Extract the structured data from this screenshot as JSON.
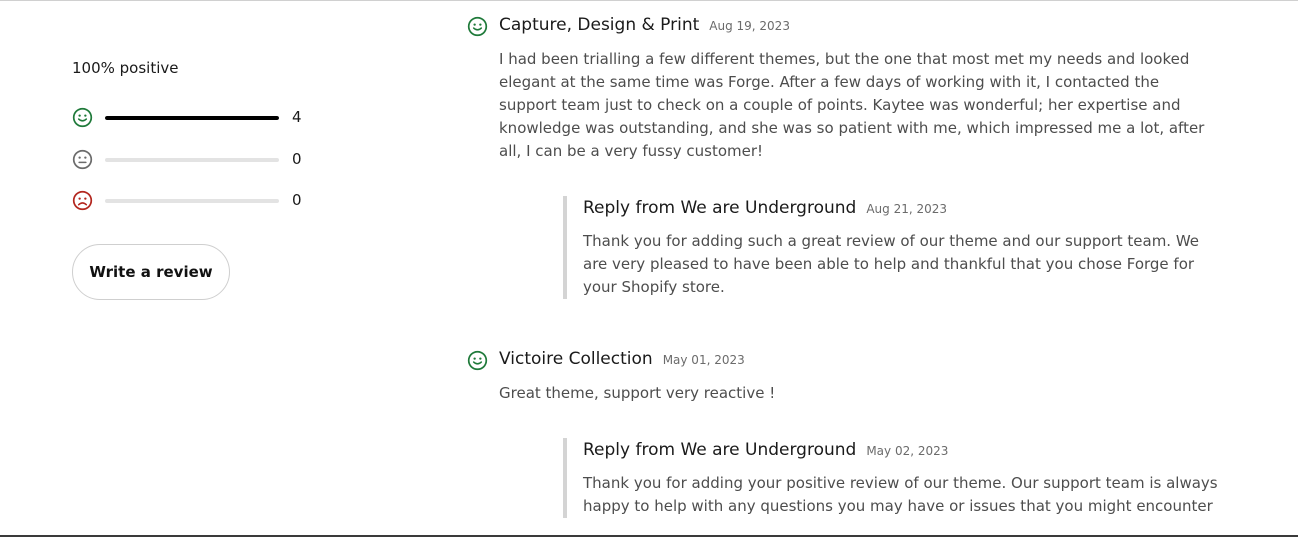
{
  "summary": {
    "title": "100% positive",
    "ratings": [
      {
        "kind": "positive",
        "icon": "smile-icon",
        "count": "4",
        "fraction": 1.0,
        "color": "#1f7a3a"
      },
      {
        "kind": "neutral",
        "icon": "neutral-face-icon",
        "count": "0",
        "fraction": 0,
        "color": "#6b6b6b"
      },
      {
        "kind": "negative",
        "icon": "frown-icon",
        "count": "0",
        "fraction": 0,
        "color": "#b3261e"
      }
    ],
    "write_review_label": "Write a review"
  },
  "reviews": [
    {
      "reviewer": "Capture, Design & Print",
      "date": "Aug 19, 2023",
      "sentiment": "positive",
      "body": "I had been trialling a few different themes, but the one that most met my needs and looked elegant at the same time was Forge. After a few days of working with it, I contacted the support team just to check on a couple of points. Kaytee was wonderful; her expertise and knowledge was outstanding, and she was so patient with me, which impressed me a lot, after all, I can be a very fussy customer!",
      "reply": {
        "title": "Reply from We are Underground",
        "date": "Aug 21, 2023",
        "body": "Thank you for adding such a great review of our theme and our support team. We are very pleased to have been able to help and thankful that you chose Forge for your Shopify store."
      }
    },
    {
      "reviewer": "Victoire Collection",
      "date": "May 01, 2023",
      "sentiment": "positive",
      "body": "Great theme, support very reactive !",
      "reply": {
        "title": "Reply from We are Underground",
        "date": "May 02, 2023",
        "body": "Thank you for adding your positive review of our theme. Our support team is always happy to help with any questions you may have or issues that you might encounter"
      }
    }
  ]
}
